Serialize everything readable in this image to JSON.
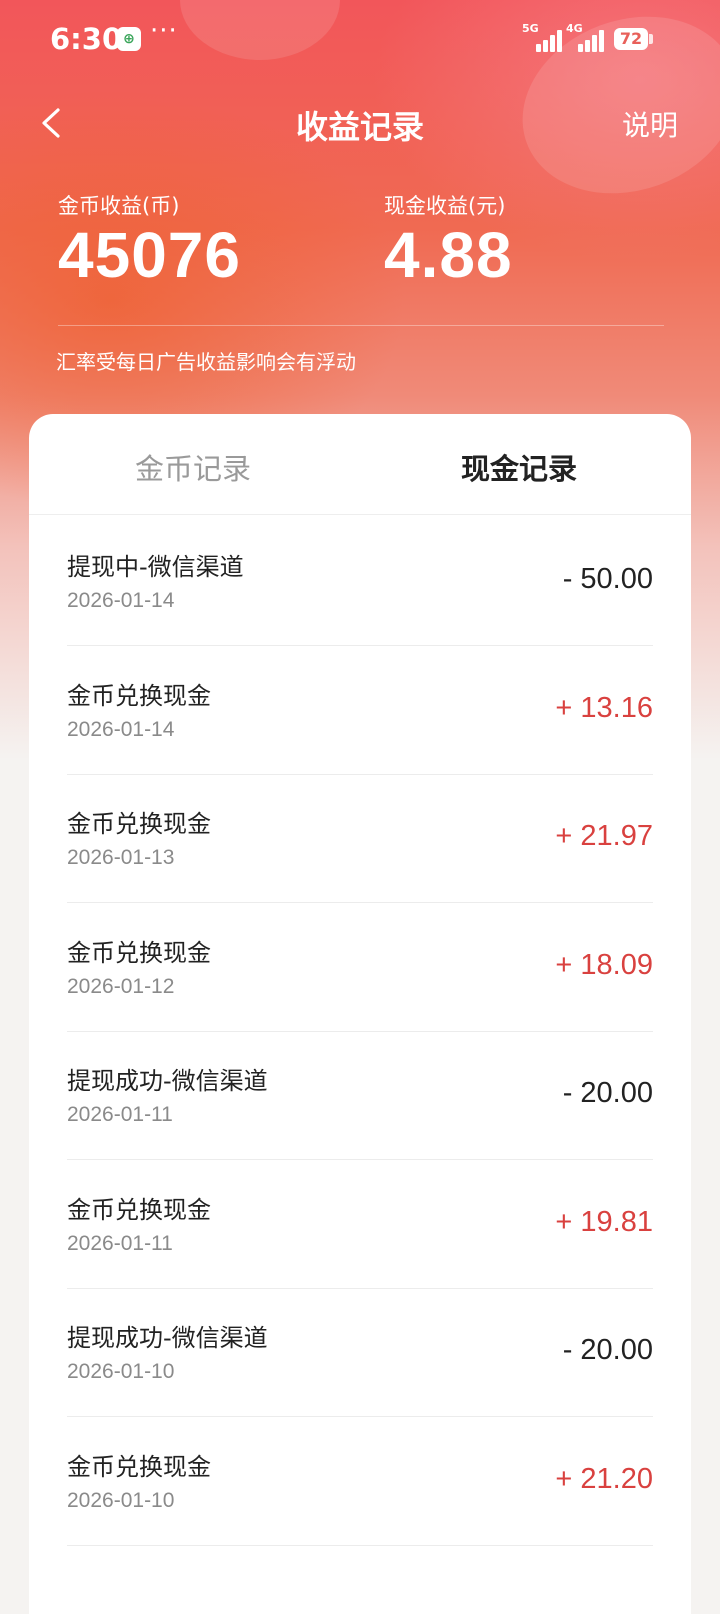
{
  "status_bar": {
    "time": "6:30",
    "more": "···",
    "signal1_label": "5G",
    "signal2_label": "4G",
    "battery": "72"
  },
  "header": {
    "title": "收益记录",
    "explain_label": "说明"
  },
  "stats": {
    "coin_label": "金币收益(币)",
    "coin_value": "45076",
    "cash_label": "现金收益(元)",
    "cash_value": "4.88",
    "note": "汇率受每日广告收益影响会有浮动"
  },
  "tabs": {
    "coin_records": "金币记录",
    "cash_records": "现金记录",
    "active": "现金记录"
  },
  "records": [
    {
      "title": "提现中-微信渠道",
      "date": "2026-01-14",
      "amount": "- 50.00",
      "type": "neg"
    },
    {
      "title": "金币兑换现金",
      "date": "2026-01-14",
      "amount": "+ 13.16",
      "type": "pos"
    },
    {
      "title": "金币兑换现金",
      "date": "2026-01-13",
      "amount": "+ 21.97",
      "type": "pos"
    },
    {
      "title": "金币兑换现金",
      "date": "2026-01-12",
      "amount": "+ 18.09",
      "type": "pos"
    },
    {
      "title": "提现成功-微信渠道",
      "date": "2026-01-11",
      "amount": "- 20.00",
      "type": "neg"
    },
    {
      "title": "金币兑换现金",
      "date": "2026-01-11",
      "amount": "+ 19.81",
      "type": "pos"
    },
    {
      "title": "提现成功-微信渠道",
      "date": "2026-01-10",
      "amount": "- 20.00",
      "type": "neg"
    },
    {
      "title": "金币兑换现金",
      "date": "2026-01-10",
      "amount": "+ 21.20",
      "type": "pos"
    }
  ],
  "colors": {
    "accent": "#f0584f",
    "positive": "#d9413f",
    "negative": "#222222"
  }
}
